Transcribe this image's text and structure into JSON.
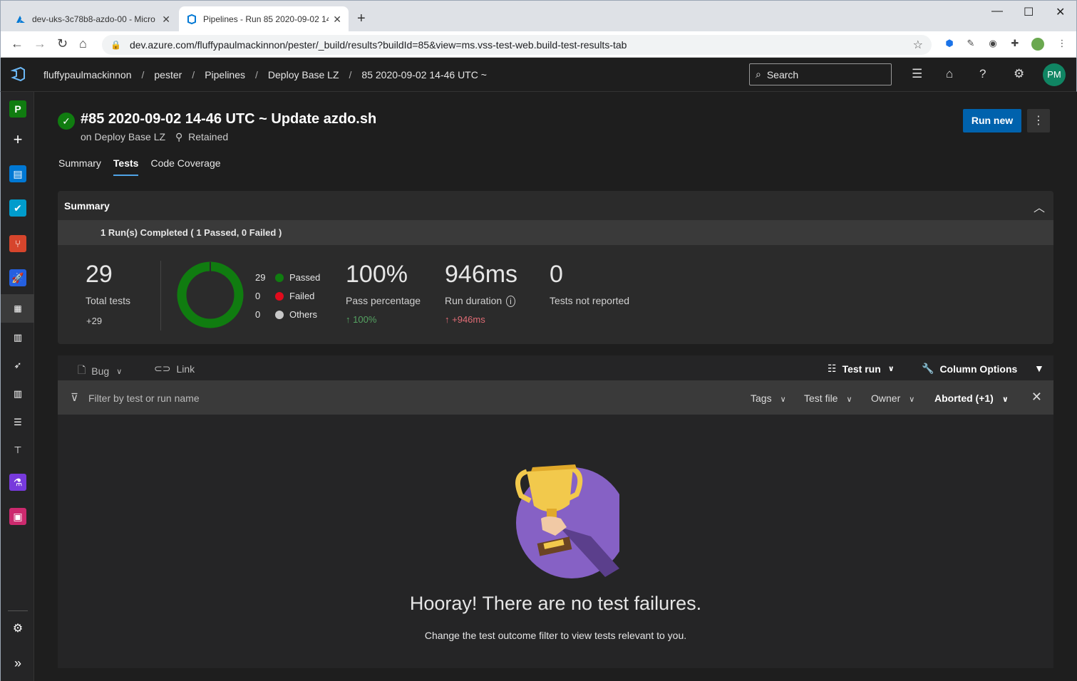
{
  "browser": {
    "tabs": [
      {
        "title": "dev-uks-3c78b8-azdo-00 - Micro"
      },
      {
        "title": "Pipelines - Run 85 2020-09-02 14"
      }
    ],
    "url": "dev.azure.com/fluffypaulmackinnon/pester/_build/results?buildId=85&view=ms.vss-test-web.build-test-results-tab"
  },
  "header": {
    "breadcrumbs": [
      "fluffypaulmackinnon",
      "pester",
      "Pipelines",
      "Deploy Base LZ",
      "85 2020-09-02 14-46 UTC ~"
    ],
    "search_placeholder": "Search",
    "avatar_initials": "PM"
  },
  "rail": {
    "project_initial": "P"
  },
  "run": {
    "title": "#85 2020-09-02 14-46 UTC ~ Update azdo.sh",
    "pipeline": "on Deploy Base LZ",
    "retained": "Retained",
    "run_new_label": "Run new"
  },
  "tabs": [
    "Summary",
    "Tests",
    "Code Coverage"
  ],
  "summary": {
    "header": "Summary",
    "runs_completed": "1 Run(s) Completed ( 1 Passed, 0 Failed )",
    "total_tests": "29",
    "total_tests_label": "Total tests",
    "total_delta": "+29",
    "legend": [
      {
        "count": "29",
        "label": "Passed",
        "color": "#107c10"
      },
      {
        "count": "0",
        "label": "Failed",
        "color": "#e00b1c"
      },
      {
        "count": "0",
        "label": "Others",
        "color": "#c8c8c8"
      }
    ],
    "pass_percentage": "100%",
    "pass_percentage_label": "Pass percentage",
    "pass_delta": "100%",
    "run_duration": "946ms",
    "run_duration_label": "Run duration",
    "duration_delta": "+946ms",
    "not_reported": "0",
    "not_reported_label": "Tests not reported"
  },
  "toolbar": {
    "bug": "Bug",
    "link": "Link",
    "test_run": "Test run",
    "column_options": "Column Options"
  },
  "filter": {
    "placeholder": "Filter by test or run name",
    "tags": "Tags",
    "test_file": "Test file",
    "owner": "Owner",
    "outcome": "Aborted (+1)"
  },
  "empty": {
    "headline": "Hooray! There are no test failures.",
    "hint": "Change the test outcome filter to view tests relevant to you."
  },
  "colors": {
    "accent": "#0062ad",
    "passed": "#107c10",
    "failed": "#e00b1c",
    "up_green": "#55a362",
    "up_red": "#e06c75"
  }
}
